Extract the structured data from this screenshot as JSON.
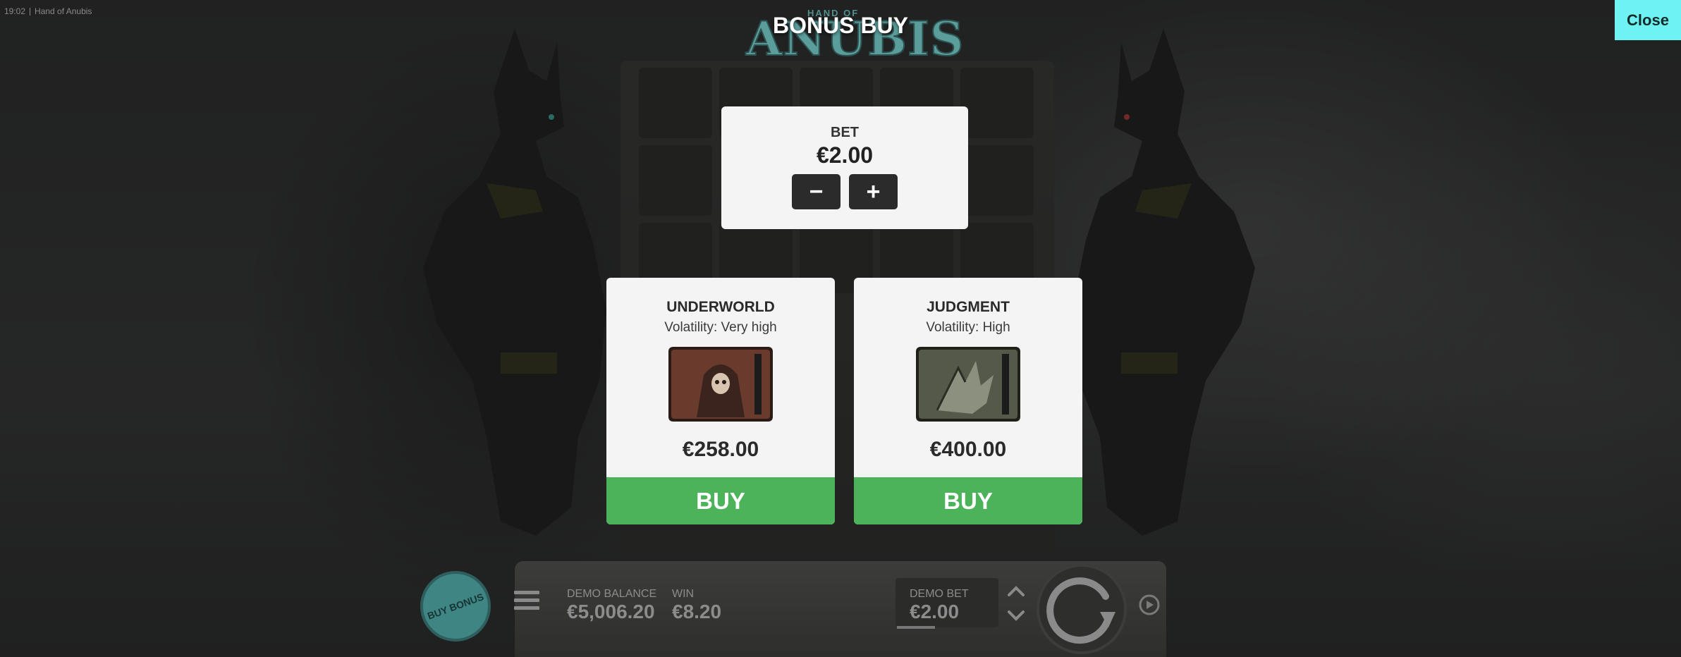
{
  "topbar": {
    "time": "19:02",
    "game_name": "Hand of Anubis"
  },
  "logo": {
    "sub": "HAND OF",
    "main": "ANUBIS"
  },
  "title": "BONUS BUY",
  "close_label": "Close",
  "bet": {
    "label": "BET",
    "value": "€2.00",
    "minus": "−",
    "plus": "+"
  },
  "cards": [
    {
      "title": "UNDERWORLD",
      "volatility": "Volatility: Very high",
      "price": "€258.00",
      "buy_label": "BUY",
      "image_icon": "reaper-icon"
    },
    {
      "title": "JUDGMENT",
      "volatility": "Volatility: High",
      "price": "€400.00",
      "buy_label": "BUY",
      "image_icon": "anubis-claw-icon"
    }
  ],
  "bottom": {
    "buy_bonus": "BUY BONUS",
    "demo_balance_label": "DEMO BALANCE",
    "demo_balance_value": "€5,006.20",
    "win_label": "WIN",
    "win_value": "€8.20",
    "demo_bet_label": "DEMO BET",
    "demo_bet_value": "€2.00"
  },
  "colors": {
    "close_bg": "#6ff3f2",
    "buy_green": "#4cb35b",
    "panel_bg": "#f4f4f4",
    "logo_teal": "#5a9d9a"
  }
}
